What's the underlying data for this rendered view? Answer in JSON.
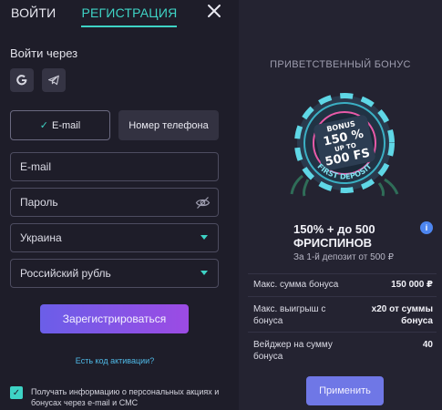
{
  "tabs": {
    "login": "ВОЙТИ",
    "register": "РЕГИСТРАЦИЯ"
  },
  "login_via": "Войти через",
  "method": {
    "email_label": "E-mail",
    "phone_label": "Номер телефона"
  },
  "form": {
    "email_placeholder": "E-mail",
    "password_placeholder": "Пароль",
    "country_value": "Украина",
    "currency_value": "Российский рубль",
    "register_label": "Зарегистрироваться",
    "activation_link": "Есть код активации?",
    "consent_checked": true,
    "consent_text": "Получать информацию о персональных акциях и бонусах через e-mail и СМС"
  },
  "bonus": {
    "heading": "ПРИВЕТСТВЕННЫЙ БОНУС",
    "chip_line1": "BONUS",
    "chip_line2": "150 %",
    "chip_line3": "UP TO",
    "chip_line4": "500 FS",
    "chip_ring": "FIRST DEPOSIT",
    "title_line1": "150% + до 500",
    "title_line2": "ФРИСПИНОВ",
    "subtitle": "За 1-й депозит от 500 ₽",
    "rows": [
      {
        "label": "Макс. сумма бонуса",
        "value": "150 000 ₽"
      },
      {
        "label": "Макс. выигрыш с бонуса",
        "value": "x20 от суммы бонуса"
      },
      {
        "label": "Вейджер на сумму бонуса",
        "value": "40"
      }
    ],
    "apply_label": "Применить"
  },
  "colors": {
    "accent": "#3ed3c5",
    "primary_gradient_start": "#6b5ee8",
    "primary_gradient_end": "#9c4be4",
    "info": "#4d86f0"
  },
  "icons": [
    "close-icon",
    "google-icon",
    "telegram-icon",
    "check-icon",
    "eye-off-icon",
    "chevron-down-icon",
    "info-icon"
  ]
}
